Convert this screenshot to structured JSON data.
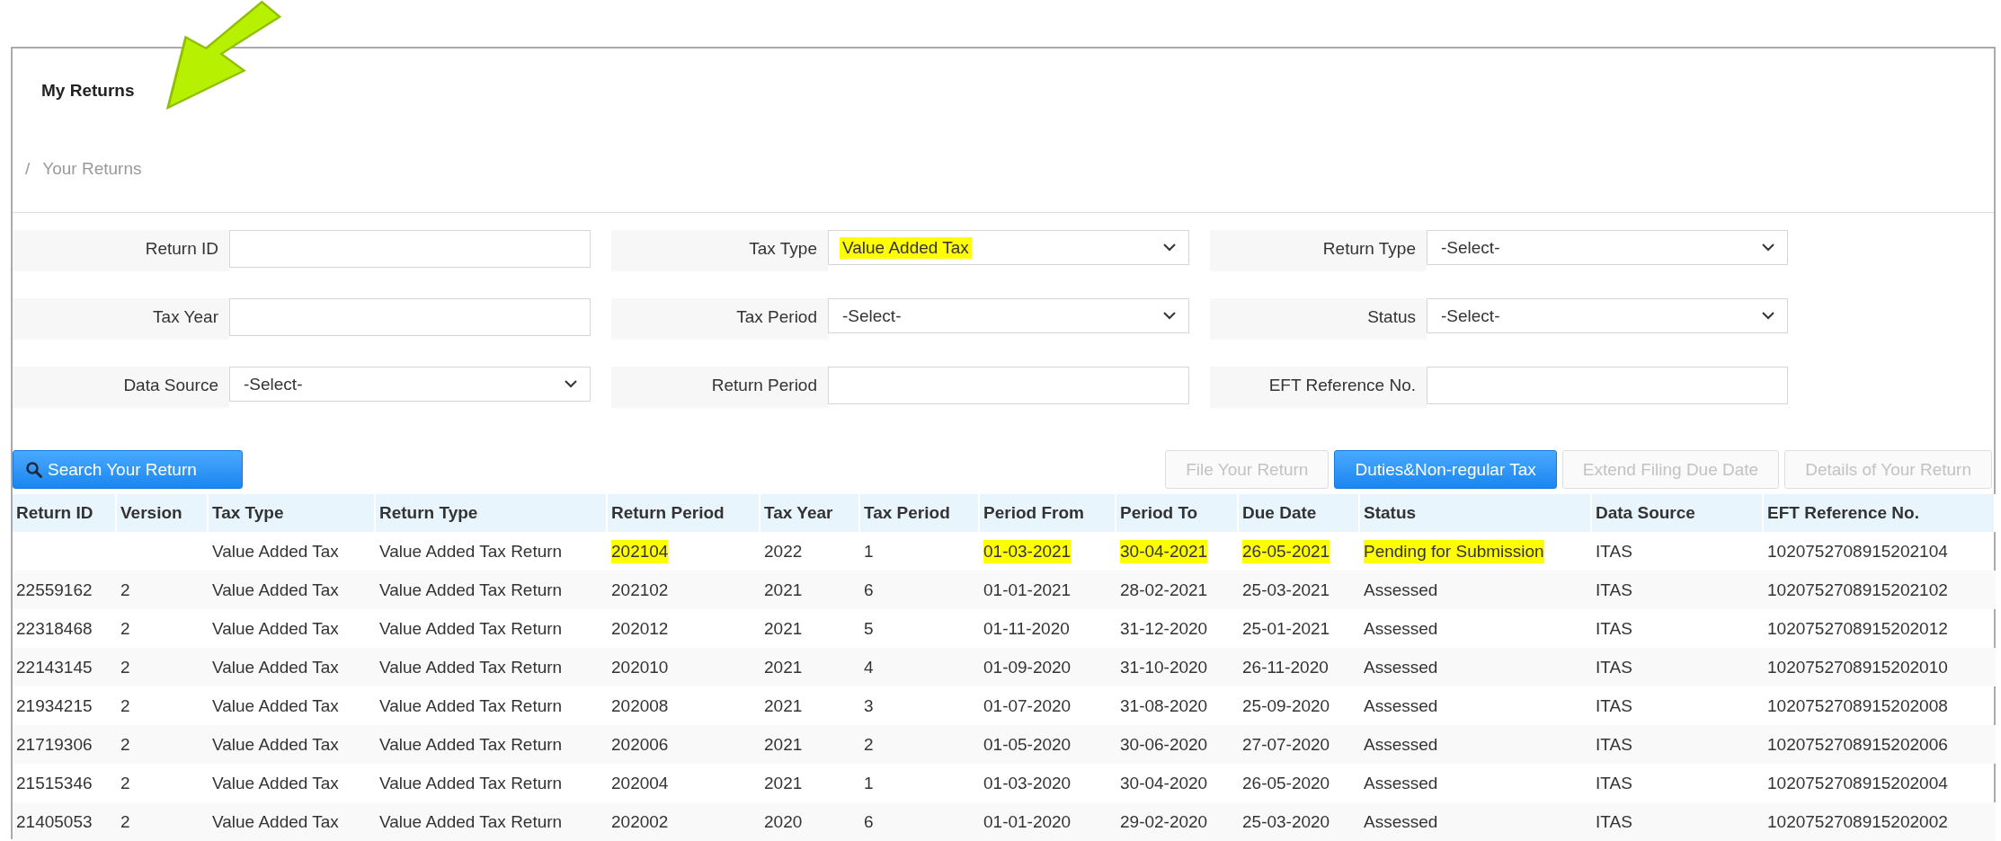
{
  "page_title": "My Returns",
  "breadcrumb": {
    "separator": "/",
    "current": "Your Returns"
  },
  "filters": [
    {
      "label": "Return ID",
      "kind": "text"
    },
    {
      "label": "Tax Type",
      "kind": "select",
      "value": "Value Added Tax",
      "highlighted": true
    },
    {
      "label": "Return Type",
      "kind": "select",
      "value": "-Select-",
      "highlighted": false
    },
    {
      "label": "Tax Year",
      "kind": "text"
    },
    {
      "label": "Tax Period",
      "kind": "select",
      "value": "-Select-",
      "highlighted": false
    },
    {
      "label": "Status",
      "kind": "select",
      "value": "-Select-",
      "highlighted": false
    },
    {
      "label": "Data Source",
      "kind": "select",
      "value": "-Select-",
      "highlighted": false
    },
    {
      "label": "Return Period",
      "kind": "text"
    },
    {
      "label": "EFT Reference No.",
      "kind": "text"
    }
  ],
  "search_button": {
    "label": "Search Your Return"
  },
  "action_buttons": [
    {
      "label": "File Your Return",
      "disabled": true
    },
    {
      "label": "Duties&Non-regular Tax",
      "disabled": false
    },
    {
      "label": "Extend Filing Due Date",
      "disabled": true
    },
    {
      "label": "Details of Your Return",
      "disabled": true
    }
  ],
  "table": {
    "columns": [
      "Return ID",
      "Version",
      "Tax Type",
      "Return Type",
      "Return Period",
      "Tax Year",
      "Tax Period",
      "Period From",
      "Period To",
      "Due Date",
      "Status",
      "Data Source",
      "EFT Reference No."
    ],
    "rows": [
      {
        "cells": [
          {},
          {},
          {
            "text": "Value Added Tax"
          },
          {
            "text": "Value Added Tax Return"
          },
          {
            "text": "202104",
            "highlighted": true
          },
          {
            "text": "2022"
          },
          {
            "text": "1"
          },
          {
            "text": "01-03-2021",
            "highlighted": true
          },
          {
            "text": "30-04-2021",
            "highlighted": true
          },
          {
            "text": "26-05-2021",
            "highlighted": true
          },
          {
            "text": "Pending for Submission",
            "highlighted": true
          },
          {
            "text": "ITAS"
          },
          {
            "text": "1020752708915202104"
          }
        ]
      },
      {
        "cells": [
          {
            "text": "22559162"
          },
          {
            "text": "2"
          },
          {
            "text": "Value Added Tax"
          },
          {
            "text": "Value Added Tax Return"
          },
          {
            "text": "202102"
          },
          {
            "text": "2021"
          },
          {
            "text": "6"
          },
          {
            "text": "01-01-2021"
          },
          {
            "text": "28-02-2021"
          },
          {
            "text": "25-03-2021"
          },
          {
            "text": "Assessed"
          },
          {
            "text": "ITAS"
          },
          {
            "text": "1020752708915202102"
          }
        ]
      },
      {
        "cells": [
          {
            "text": "22318468"
          },
          {
            "text": "2"
          },
          {
            "text": "Value Added Tax"
          },
          {
            "text": "Value Added Tax Return"
          },
          {
            "text": "202012"
          },
          {
            "text": "2021"
          },
          {
            "text": "5"
          },
          {
            "text": "01-11-2020"
          },
          {
            "text": "31-12-2020"
          },
          {
            "text": "25-01-2021"
          },
          {
            "text": "Assessed"
          },
          {
            "text": "ITAS"
          },
          {
            "text": "1020752708915202012"
          }
        ]
      },
      {
        "cells": [
          {
            "text": "22143145"
          },
          {
            "text": "2"
          },
          {
            "text": "Value Added Tax"
          },
          {
            "text": "Value Added Tax Return"
          },
          {
            "text": "202010"
          },
          {
            "text": "2021"
          },
          {
            "text": "4"
          },
          {
            "text": "01-09-2020"
          },
          {
            "text": "31-10-2020"
          },
          {
            "text": "26-11-2020"
          },
          {
            "text": "Assessed"
          },
          {
            "text": "ITAS"
          },
          {
            "text": "1020752708915202010"
          }
        ]
      },
      {
        "cells": [
          {
            "text": "21934215"
          },
          {
            "text": "2"
          },
          {
            "text": "Value Added Tax"
          },
          {
            "text": "Value Added Tax Return"
          },
          {
            "text": "202008"
          },
          {
            "text": "2021"
          },
          {
            "text": "3"
          },
          {
            "text": "01-07-2020"
          },
          {
            "text": "31-08-2020"
          },
          {
            "text": "25-09-2020"
          },
          {
            "text": "Assessed"
          },
          {
            "text": "ITAS"
          },
          {
            "text": "1020752708915202008"
          }
        ]
      },
      {
        "cells": [
          {
            "text": "21719306"
          },
          {
            "text": "2"
          },
          {
            "text": "Value Added Tax"
          },
          {
            "text": "Value Added Tax Return"
          },
          {
            "text": "202006"
          },
          {
            "text": "2021"
          },
          {
            "text": "2"
          },
          {
            "text": "01-05-2020"
          },
          {
            "text": "30-06-2020"
          },
          {
            "text": "27-07-2020"
          },
          {
            "text": "Assessed"
          },
          {
            "text": "ITAS"
          },
          {
            "text": "1020752708915202006"
          }
        ]
      },
      {
        "cells": [
          {
            "text": "21515346"
          },
          {
            "text": "2"
          },
          {
            "text": "Value Added Tax"
          },
          {
            "text": "Value Added Tax Return"
          },
          {
            "text": "202004"
          },
          {
            "text": "2021"
          },
          {
            "text": "1"
          },
          {
            "text": "01-03-2020"
          },
          {
            "text": "30-04-2020"
          },
          {
            "text": "26-05-2020"
          },
          {
            "text": "Assessed"
          },
          {
            "text": "ITAS"
          },
          {
            "text": "1020752708915202004"
          }
        ]
      },
      {
        "cells": [
          {
            "text": "21405053"
          },
          {
            "text": "2"
          },
          {
            "text": "Value Added Tax"
          },
          {
            "text": "Value Added Tax Return"
          },
          {
            "text": "202002"
          },
          {
            "text": "2020"
          },
          {
            "text": "6"
          },
          {
            "text": "01-01-2020"
          },
          {
            "text": "29-02-2020"
          },
          {
            "text": "25-03-2020"
          },
          {
            "text": "Assessed"
          },
          {
            "text": "ITAS"
          },
          {
            "text": "1020752708915202002"
          }
        ]
      }
    ]
  }
}
